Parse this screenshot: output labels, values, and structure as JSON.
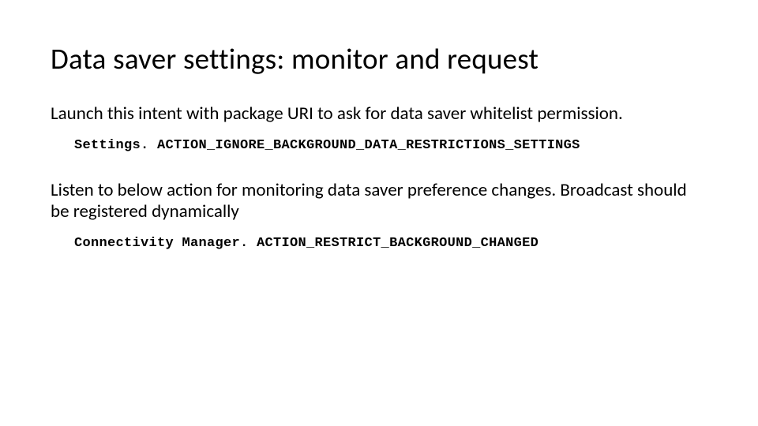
{
  "title": "Data saver settings: monitor and request",
  "paragraph1": "Launch this intent with package URI to ask for data saver whitelist permission.",
  "code1": "Settings. ACTION_IGNORE_BACKGROUND_DATA_RESTRICTIONS_SETTINGS",
  "paragraph2": "Listen to below action for monitoring data saver preference changes. Broadcast should be registered dynamically",
  "code2": "Connectivity Manager. ACTION_RESTRICT_BACKGROUND_CHANGED"
}
